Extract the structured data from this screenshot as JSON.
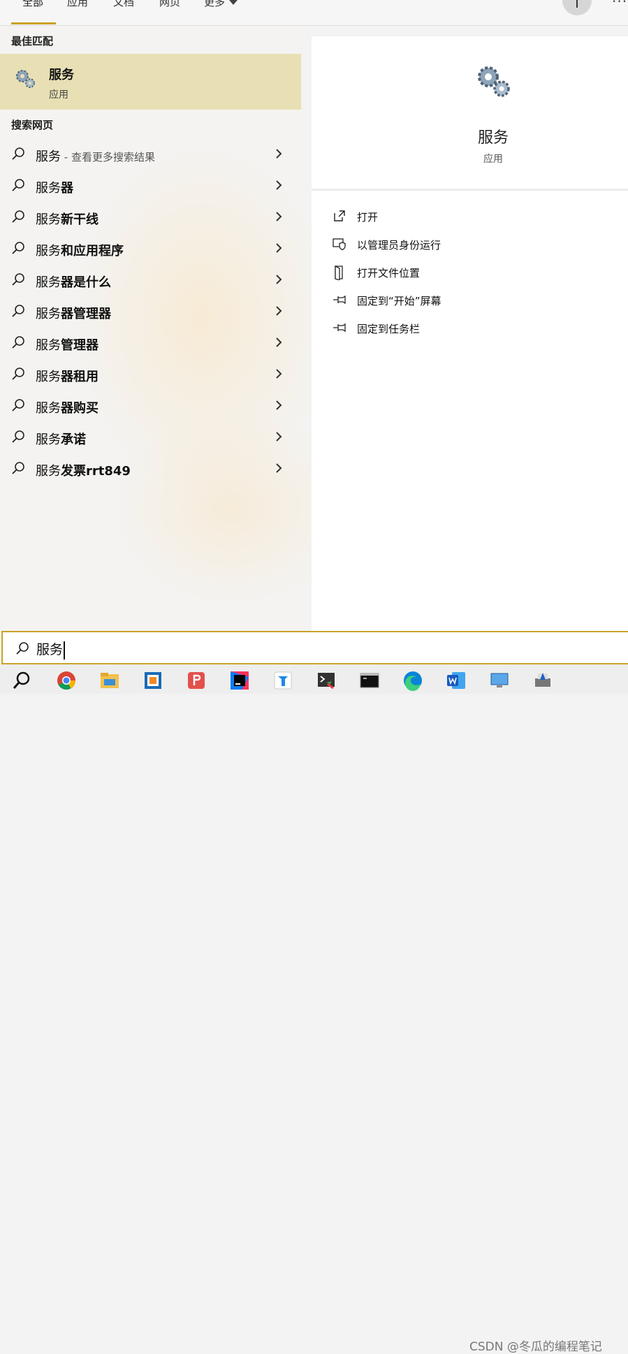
{
  "tabs": [
    {
      "label": "全部",
      "active": true
    },
    {
      "label": "应用"
    },
    {
      "label": "文档"
    },
    {
      "label": "网页"
    },
    {
      "label": "更多"
    }
  ],
  "header": {
    "avatar_letter": "T",
    "more_dots": "···"
  },
  "best_match": {
    "section_title": "最佳匹配",
    "name": "服务",
    "type": "应用",
    "icon": "gears-icon"
  },
  "web": {
    "section_title": "搜索网页",
    "results": [
      {
        "prefix": "服务",
        "bold": "",
        "sub": " - 查看更多搜索结果"
      },
      {
        "prefix": "服务",
        "bold": "器",
        "sub": ""
      },
      {
        "prefix": "服务",
        "bold": "新干线",
        "sub": ""
      },
      {
        "prefix": "服务",
        "bold": "和应用程序",
        "sub": ""
      },
      {
        "prefix": "服务",
        "bold": "器是什么",
        "sub": ""
      },
      {
        "prefix": "服务",
        "bold": "器管理器",
        "sub": ""
      },
      {
        "prefix": "服务",
        "bold": "管理器",
        "sub": ""
      },
      {
        "prefix": "服务",
        "bold": "器租用",
        "sub": ""
      },
      {
        "prefix": "服务",
        "bold": "器购买",
        "sub": ""
      },
      {
        "prefix": "服务",
        "bold": "承诺",
        "sub": ""
      },
      {
        "prefix": "服务",
        "bold": "发票rrt849",
        "sub": ""
      }
    ]
  },
  "preview": {
    "name": "服务",
    "type": "应用",
    "actions": [
      {
        "label": "打开",
        "icon": "open-icon"
      },
      {
        "label": "以管理员身份运行",
        "icon": "shield-icon"
      },
      {
        "label": "打开文件位置",
        "icon": "file-location-icon"
      },
      {
        "label": "固定到“开始”屏幕",
        "icon": "pin-icon"
      },
      {
        "label": "固定到任务栏",
        "icon": "pin-icon"
      }
    ]
  },
  "search": {
    "value": "服务"
  },
  "taskbar": {
    "apps": [
      "search-icon",
      "chrome-icon",
      "file-explorer-icon",
      "virtualbox-icon",
      "wps-pdf-icon",
      "intellij-icon",
      "typora-icon",
      "terminal-app-icon",
      "cmd-icon",
      "edge-icon",
      "word-icon",
      "remote-desktop-icon",
      "printer-icon"
    ]
  },
  "watermark": "CSDN @冬瓜的编程笔记",
  "colors": {
    "accent": "#c9a227",
    "best_match_bg": "#e8e0b4"
  }
}
